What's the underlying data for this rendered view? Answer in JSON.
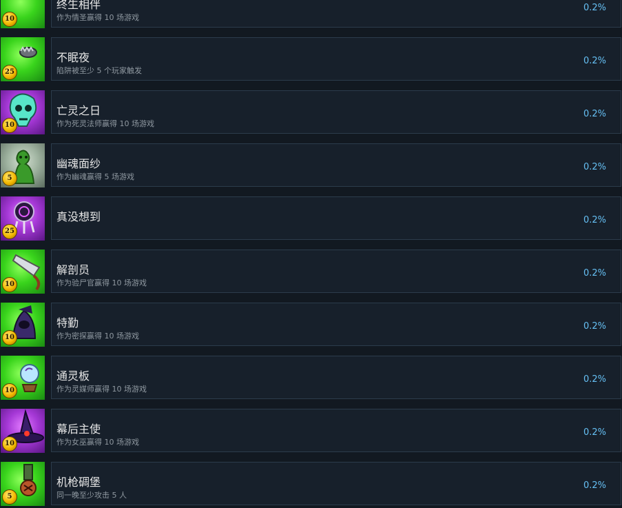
{
  "achievements": [
    {
      "title": "终生相伴",
      "description": "作为情圣赢得 10 场游戏",
      "points": "10",
      "percent": "0.2%",
      "bg": "green",
      "icon": "rose-sword-icon"
    },
    {
      "title": "不眠夜",
      "description": "陷阱被至少 5 个玩家触发",
      "points": "25",
      "percent": "0.2%",
      "bg": "green",
      "icon": "bear-trap-icon"
    },
    {
      "title": "亡灵之日",
      "description": "作为死灵法师赢得 10 场游戏",
      "points": "10",
      "percent": "0.2%",
      "bg": "purple",
      "icon": "ghost-skull-icon"
    },
    {
      "title": "幽魂面纱",
      "description": "作为幽魂赢得 5 场游戏",
      "points": "5",
      "percent": "0.2%",
      "bg": "gray",
      "icon": "veil-ghost-icon"
    },
    {
      "title": "真没想到",
      "description": "",
      "points": "25",
      "percent": "0.2%",
      "bg": "purple",
      "icon": "dreamcatcher-icon"
    },
    {
      "title": "解剖员",
      "description": "作为验尸官赢得 10 场游戏",
      "points": "10",
      "percent": "0.2%",
      "bg": "green",
      "icon": "bone-saw-icon"
    },
    {
      "title": "特勤",
      "description": "作为密探赢得 10 场游戏",
      "points": "10",
      "percent": "0.2%",
      "bg": "green",
      "icon": "hooded-spy-icon"
    },
    {
      "title": "通灵板",
      "description": "作为灵媒师赢得 10 场游戏",
      "points": "10",
      "percent": "0.2%",
      "bg": "green",
      "icon": "crystal-ball-icon"
    },
    {
      "title": "幕后主使",
      "description": "作为女巫赢得 10 场游戏",
      "points": "10",
      "percent": "0.2%",
      "bg": "purple",
      "icon": "witch-hat-icon"
    },
    {
      "title": "机枪碉堡",
      "description": "同一晚至少攻击 5 人",
      "points": "5",
      "percent": "0.2%",
      "bg": "green",
      "icon": "medal-icon"
    }
  ]
}
